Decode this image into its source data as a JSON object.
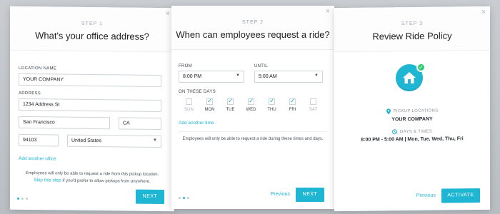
{
  "card1": {
    "step": "STEP 1",
    "title": "What's your office address?",
    "location_label": "LOCATION NAME",
    "location_value": "YOUR COMPANY",
    "address_label": "ADDRESS",
    "street": "1234 Address St",
    "city": "San Francisco",
    "state": "CA",
    "zip": "94103",
    "country": "United States",
    "add_office": "Add another office",
    "note_line1": "Employees will only be able to request a ride from this pickup location.",
    "skip_link": "Skip this step",
    "note_line2": " if you'd prefer to allow pickups from anywhere.",
    "next": "NEXT"
  },
  "card2": {
    "step": "STEP 2",
    "title": "When can employees request a ride?",
    "from_label": "FROM",
    "from_value": "8:00 PM",
    "until_label": "UNTIL",
    "until_value": "5:00 AM",
    "days_label": "ON THESE DAYS",
    "days": [
      {
        "name": "SUN",
        "checked": false
      },
      {
        "name": "MON",
        "checked": true
      },
      {
        "name": "TUE",
        "checked": true
      },
      {
        "name": "WED",
        "checked": true
      },
      {
        "name": "THU",
        "checked": true
      },
      {
        "name": "FRI",
        "checked": true
      },
      {
        "name": "SAT",
        "checked": false
      }
    ],
    "add_time": "Add another time",
    "note": "Employees will only be able to request a ride during these times and days.",
    "previous": "Previous",
    "next": "NEXT"
  },
  "card3": {
    "step": "STEP 3",
    "title": "Review Ride Policy",
    "pickup_label": "PICKUP LOCATIONS",
    "pickup_value": "YOUR COMPANY",
    "days_label": "DAYS & TIMES",
    "days_value": "8:00 PM - 5:00 AM | Mon, Tue, Wed, Thu, Fri",
    "previous": "Previous",
    "activate": "ACTIVATE"
  },
  "colors": {
    "accent": "#1fb6d3",
    "success": "#2ecc71"
  },
  "icons": {
    "close": "×",
    "caret": "▼",
    "home": "home-icon",
    "pin": "pin-icon",
    "clock": "clock-icon"
  }
}
